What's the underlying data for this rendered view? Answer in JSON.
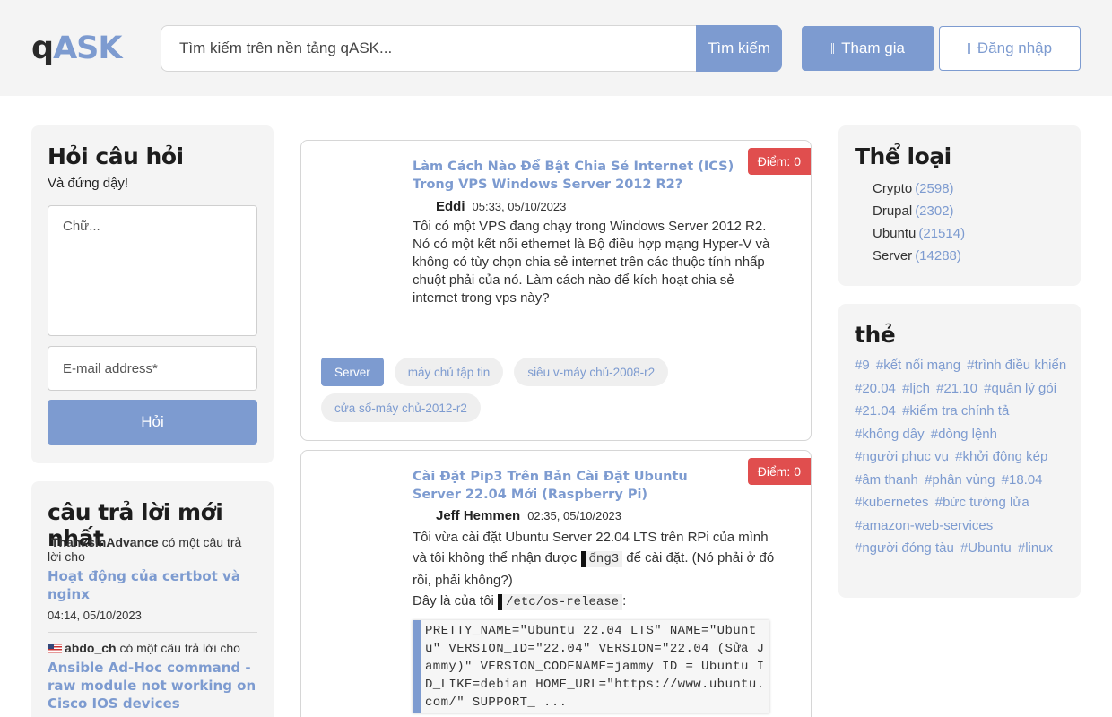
{
  "header": {
    "logo_q": "q",
    "logo_ask": "ASK",
    "search_placeholder": "Tìm kiếm trên nền tảng qASK...",
    "search_button": "Tìm kiếm",
    "join_button": "Tham gia",
    "login_button": "Đăng nhập"
  },
  "ask_panel": {
    "title": "Hỏi câu hỏi",
    "subtitle": "Và đứng dậy!",
    "text_placeholder": "Chữ...",
    "email_placeholder": "E-mail address*",
    "submit_button": "Hỏi"
  },
  "latest_panel": {
    "title": "câu trả lời mới nhất",
    "items": [
      {
        "user": "ThanksInAdvance",
        "action": "có một câu trả lời cho",
        "link": "Hoạt động của certbot và nginx",
        "time": "04:14, 05/10/2023"
      },
      {
        "user": "abdo_ch",
        "action": "có một câu trả lời cho",
        "link": "Ansible Ad-Hoc command - raw module not working on Cisco IOS devices",
        "time": ""
      }
    ]
  },
  "questions": [
    {
      "score": "Điểm: 0",
      "title": "Làm Cách Nào Để Bật Chia Sẻ Internet (ICS) Trong VPS Windows Server 2012 R2?",
      "author": "Eddi",
      "time": "05:33, 05/10/2023",
      "body": "Tôi có một VPS đang chạy trong Windows Server 2012 R2. Nó có một kết nối ethernet là Bộ điều hợp mạng Hyper-V và không có tùy chọn chia sẻ internet trên các thuộc tính nhấp chuột phải của nó. Làm cách nào để kích hoạt chia sẻ internet trong vps này?",
      "tags": [
        "Server",
        "máy chủ tập tin",
        "siêu v-máy chủ-2008-r2",
        "cửa sổ-máy chủ-2012-r2"
      ]
    },
    {
      "score": "Điểm: 0",
      "title": "Cài Đặt Pip3 Trên Bản Cài Đặt Ubuntu Server 22.04 Mới (Raspberry Pi)",
      "author": "Jeff Hemmen",
      "time": "02:35, 05/10/2023",
      "body_part1": "Tôi vừa cài đặt Ubuntu Server 22.04 LTS trên RPi của mình và tôi không thể nhận được",
      "body_code": "ống3",
      "body_part2": "để cài đặt. (Nó phải ở đó rồi, phải không?)",
      "line2_text": "Đây là của tôi",
      "line2_code": "/etc/os-release",
      "line2_end": ":",
      "code_block": "PRETTY_NAME=\"Ubuntu 22.04 LTS\" NAME=\"Ubuntu\" VERSION_ID=\"22.04\" VERSION=\"22.04 (Sửa Jammy)\" VERSION_CODENAME=jammy ID = Ubuntu ID_LIKE=debian HOME_URL=\"https://www.ubuntu.com/\" SUPPORT_ ..."
    }
  ],
  "categories": {
    "title": "Thể loại",
    "items": [
      {
        "name": "Crypto",
        "count": "(2598)"
      },
      {
        "name": "Drupal",
        "count": "(2302)"
      },
      {
        "name": "Ubuntu",
        "count": "(21514)"
      },
      {
        "name": "Server",
        "count": "(14288)"
      }
    ]
  },
  "tags_panel": {
    "title": "thẻ",
    "tags": [
      "#9",
      "#kết nối mạng",
      "#trình điều khiển",
      "#20.04",
      "#lịch",
      "#21.10",
      "#quản lý gói",
      "#21.04",
      "#kiểm tra chính tả",
      "#không dây",
      "#dòng lệnh",
      "#người phục vụ",
      "#khởi động kép",
      "#âm thanh",
      "#phân vùng",
      "#18.04",
      "#kubernetes",
      "#bức tường lửa",
      "#amazon-web-services",
      "#người đóng tàu",
      "#Ubuntu",
      "#linux"
    ]
  },
  "colors": {
    "accent": "#7d9bd0",
    "score_badge": "#e04e4e",
    "panel_bg": "#f4f4f4"
  }
}
